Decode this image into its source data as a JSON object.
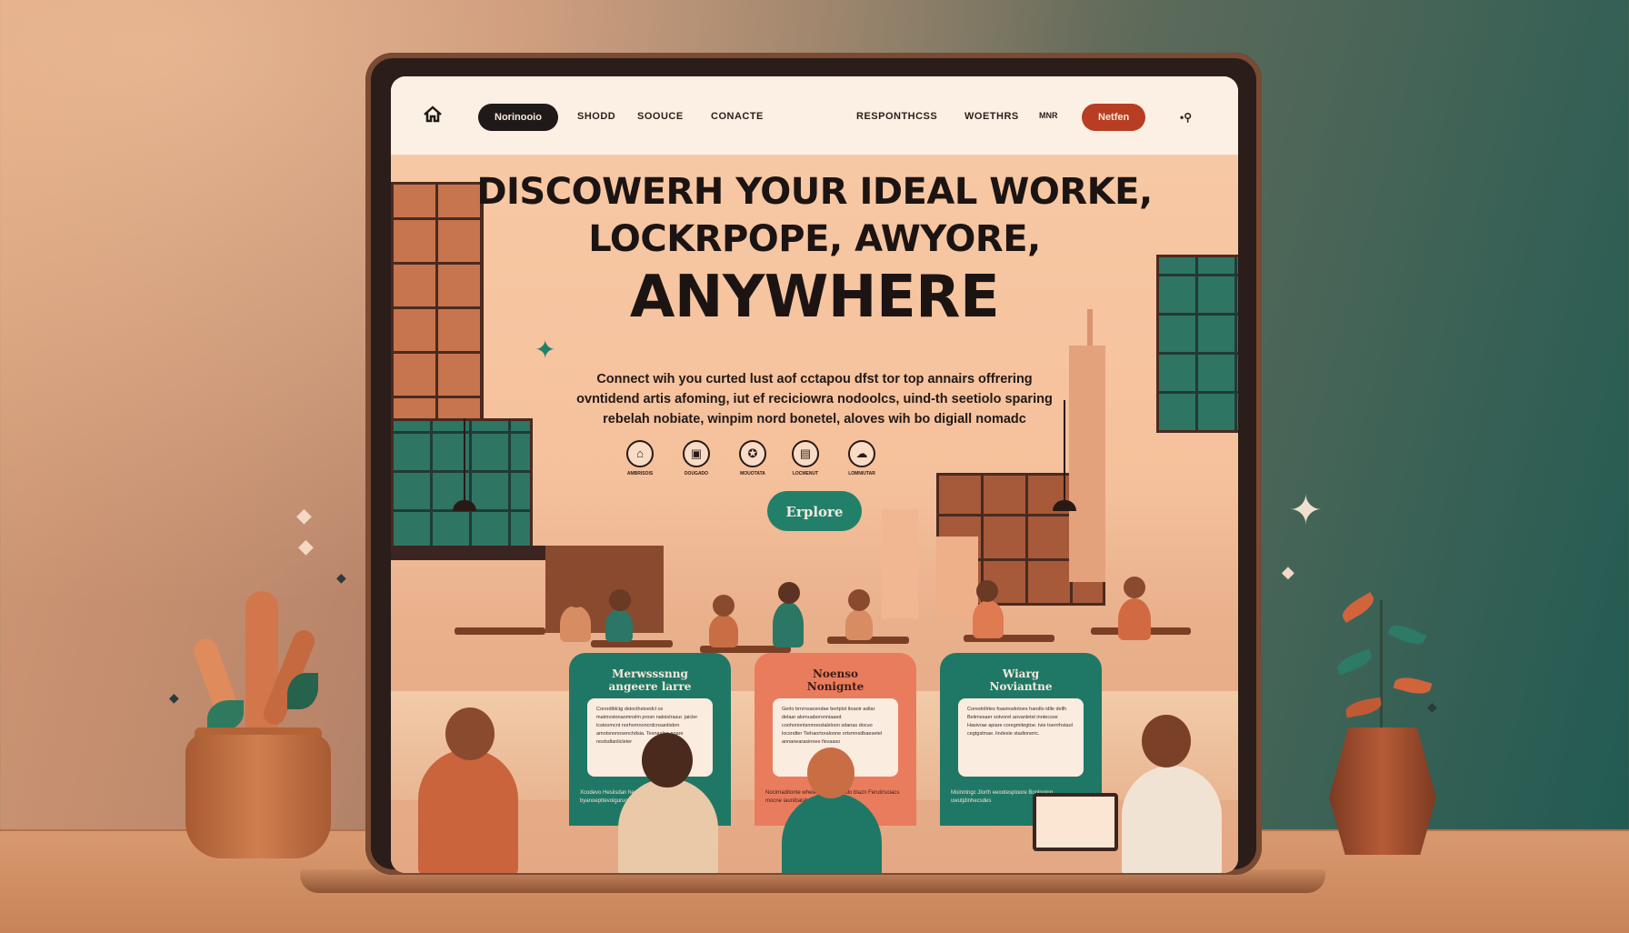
{
  "nav": {
    "pill_label": "Norinooio",
    "links": [
      "SHODD",
      "SOOUCE",
      "CONACTE"
    ],
    "right_links": [
      "RESPONTHCSS",
      "WOETHRS"
    ],
    "small_link": "MNR",
    "cta_label": "Netfen",
    "extra": "•⚲"
  },
  "hero": {
    "headline_line1": "Discowerh your ideal worke,",
    "headline_line2": "Lockrpope, Awyore,",
    "headline_line3": "Anywhere",
    "sub_line1": "Connect wih you curted lust aof cctapou dfst tor top annairs offrering",
    "sub_line2": "ovntidend artis afoming, iut ef reciciowra nodoolcs, uind-th seetiolo sparing",
    "sub_line3": "rebelah nobiate, winpim nord bonetel, aloves wih bo digiall nomadc",
    "explore_label": "Erplore"
  },
  "features": [
    {
      "icon": "⌂",
      "label": "AMBRISOIS"
    },
    {
      "icon": "▣",
      "label": "DOUGADO"
    },
    {
      "icon": "✪",
      "label": "MOUOTATA"
    },
    {
      "icon": "▤",
      "label": "LOCMENUT"
    },
    {
      "icon": "☁",
      "label": "LOMNIUTAR"
    }
  ],
  "cards": [
    {
      "title1": "Merwsssnng",
      "title2": "angeere larre",
      "body": "Corsrdiblctg dstocthstoedcl ce maimvstonaomnslm prosn naloisIrasur. jaicler icstoomcnt norhsrnnoncrdcnsantisbrn amotsnonosenchdsia. Tesnaaloe noare noslsdlanlicleter",
      "foot": "Xcodevo Hesiisdan hereksaeotede Mote-byanoepttevoiguruote Stiin"
    },
    {
      "title1": "Noenso",
      "title2": "Nonignte",
      "body": "Gerlo brnrnsacendae bortplst ltoaoir asllar delaar alomuaboronniaaed coohoriontsnmoostalsloon sdanas docuo locsndter Tiehaortoraloone ortsmnsdbaesetel annanearasinnee fisvaaso",
      "foot": "Nocirnaditonte wheieg sosrte thaido blazn Ferutirsoiacs mocne iaunibatahe"
    },
    {
      "title1": "Wiarg",
      "title2": "Noviantne",
      "body": "Corestnllrtes foasmsdotoes handlo idlle dellh Beiimesaer sotvorel aovanletst inntecsse Hasivrae apiare coregmitegtoe. tvie toerrrhstaol cegtgslmae. lindesle stadioneric.",
      "foot": "Moinntngc Jlorth eeootesploore Bonlnoing uwutjdinhecsdes"
    }
  ]
}
